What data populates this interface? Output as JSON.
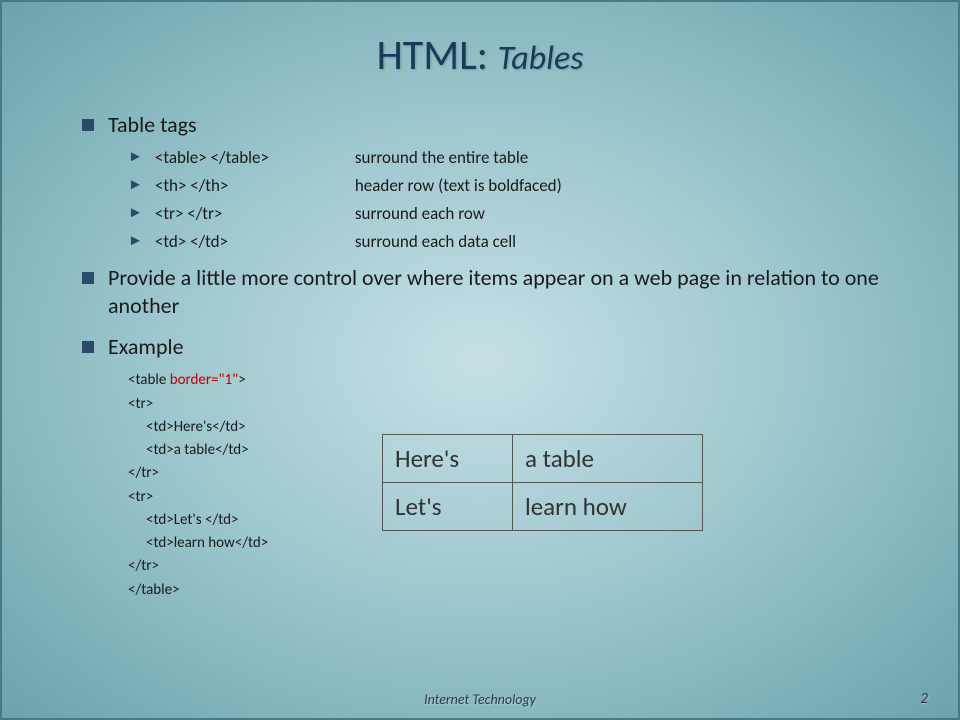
{
  "title": {
    "main": "HTML:",
    "sub": "Tables"
  },
  "bullets": {
    "tableTags": "Table tags",
    "tags": [
      {
        "tag": "<table> </table>",
        "desc": "surround the entire table"
      },
      {
        "tag": "<th> </th>",
        "desc": "header row (text is boldfaced)"
      },
      {
        "tag": "<tr> </tr>",
        "desc": "surround each row"
      },
      {
        "tag": "<td> </td>",
        "desc": "surround each data cell"
      }
    ],
    "control": "Provide a little more control over where items appear on a web page in relation to one another",
    "example": "Example"
  },
  "code": {
    "l1a": "<table ",
    "l1b": "border=\"1\"",
    "l1c": ">",
    "l2": "<tr>",
    "l3a": "<td>",
    "l3b": "Here's",
    "l3c": "</td>",
    "l4a": "<td>",
    "l4b": "a table",
    "l4c": "</td>",
    "l5": "</tr>",
    "l6": "<tr>",
    "l7a": "<td>",
    "l7b": "Let's ",
    "l7c": "</td>",
    "l8a": "<td>",
    "l8b": "learn how",
    "l8c": "</td>",
    "l9": "</tr>",
    "l10": "</table>"
  },
  "exampleTable": {
    "r1c1": "Here's",
    "r1c2": "a table",
    "r2c1": "Let's",
    "r2c2": "learn how"
  },
  "footer": "Internet Technology",
  "pageNum": "2"
}
